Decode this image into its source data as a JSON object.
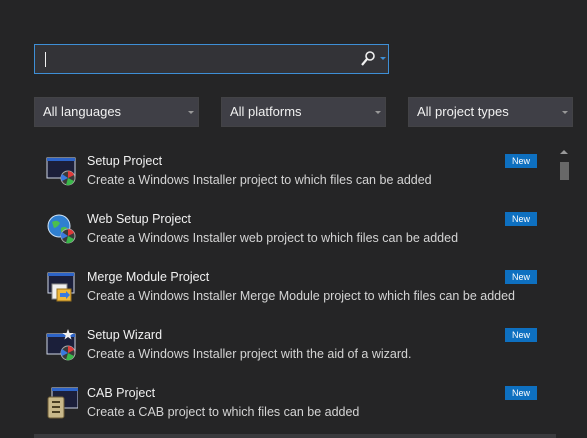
{
  "search": {
    "value": "",
    "placeholder": ""
  },
  "filters": {
    "language": "All languages",
    "platform": "All platforms",
    "project_type": "All project types"
  },
  "templates": [
    {
      "title": "Setup Project",
      "description": "Create a Windows Installer project to which files can be added",
      "badge": "New",
      "icon": "setup-project-icon"
    },
    {
      "title": "Web Setup Project",
      "description": "Create a Windows Installer web project to which files can be added",
      "badge": "New",
      "icon": "web-setup-project-icon"
    },
    {
      "title": "Merge Module Project",
      "description": "Create a Windows Installer Merge Module project to which files can be added",
      "badge": "New",
      "icon": "merge-module-icon"
    },
    {
      "title": "Setup Wizard",
      "description": "Create a Windows Installer project with the aid of a wizard.",
      "badge": "New",
      "icon": "setup-wizard-icon"
    },
    {
      "title": "CAB Project",
      "description": "Create a CAB project to which files can be added",
      "badge": "New",
      "icon": "cab-project-icon"
    }
  ],
  "colors": {
    "background": "#252526",
    "accent": "#3e8fd6",
    "badge": "#0e70c0"
  }
}
